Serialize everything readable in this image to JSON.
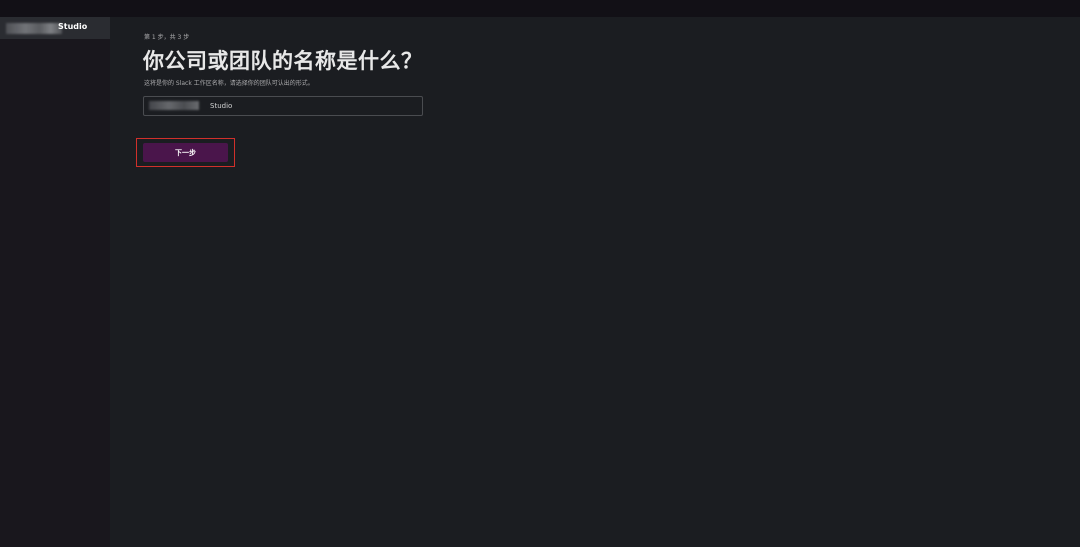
{
  "sidebar": {
    "workspace_name": "Studio"
  },
  "main": {
    "step_label": "第 1 步，共 3 步",
    "title": "你公司或团队的名称是什么？",
    "subtitle": "这将是你的 Slack 工作区名称，请选择你的团队可认出的形式。",
    "name_input": {
      "value": "Studio",
      "placeholder": ""
    },
    "next_button_label": "下一步"
  },
  "colors": {
    "topbar": "#121016",
    "sidebar": "#19171d",
    "main_background": "#1b1d21",
    "button_primary": "#4a154b",
    "highlight": "#d0302b"
  }
}
